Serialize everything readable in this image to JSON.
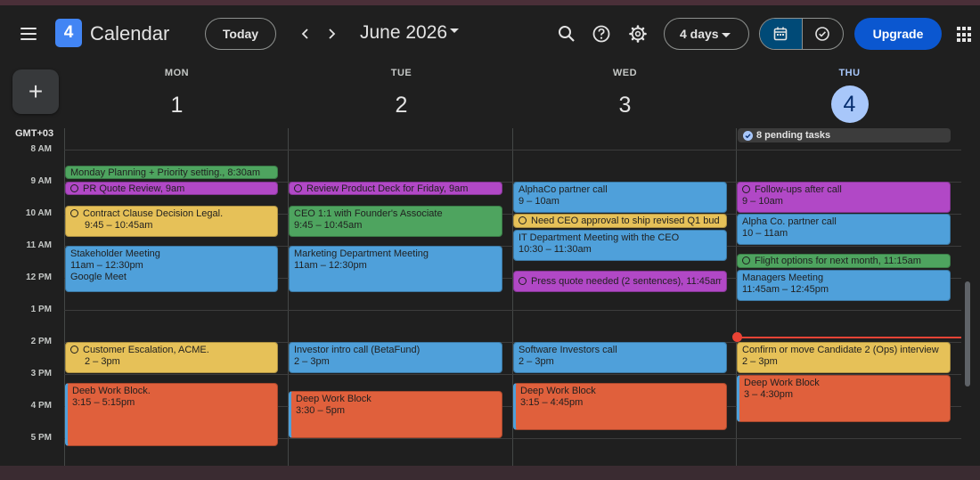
{
  "header": {
    "logo_day": "4",
    "app_title": "Calendar",
    "today_label": "Today",
    "prev_glyph": "‹",
    "next_glyph": "›",
    "month_label": "June 2026",
    "view_label": "4 days",
    "upgrade_label": "Upgrade",
    "icons": [
      "menu-icon",
      "search-icon",
      "help-icon",
      "gear-icon",
      "calendar-icon",
      "tasks-check-icon",
      "apps-grid-icon"
    ]
  },
  "sidebar": {
    "create_glyph": "+",
    "timezone": "GMT+03"
  },
  "days": [
    {
      "dow": "MON",
      "num": "1"
    },
    {
      "dow": "TUE",
      "num": "2"
    },
    {
      "dow": "WED",
      "num": "3"
    },
    {
      "dow": "THU",
      "num": "4"
    }
  ],
  "hours": [
    "8 AM",
    "9 AM",
    "10 AM",
    "11 AM",
    "12 PM",
    "1 PM",
    "2 PM",
    "3 PM",
    "4 PM",
    "5 PM"
  ],
  "pending_tasks": "8 pending tasks",
  "colors": {
    "green": "#4ea45f",
    "purple": "#b148c6",
    "yellow": "#e6c158",
    "blue": "#4fa0da",
    "orange": "#e0603c",
    "today": "#a8c7fa",
    "now_line": "#ea4335"
  },
  "events": {
    "mon": [
      {
        "title": "Monday Planning + Priority setting., 8:30am"
      },
      {
        "title": "PR Quote Review, 9am"
      },
      {
        "title": "Contract Clause Decision Legal.",
        "time": "9:45 – 10:45am"
      },
      {
        "title": "Stakeholder Meeting",
        "time": "11am – 12:30pm",
        "location": "Google Meet"
      },
      {
        "title": "Customer Escalation, ACME.",
        "time": "2 – 3pm"
      },
      {
        "title": "Deeb Work Block.",
        "time": "3:15 – 5:15pm"
      }
    ],
    "tue": [
      {
        "title": "Review Product Deck for Friday, 9am"
      },
      {
        "title": "CEO 1:1 with Founder's Associate",
        "time": "9:45 – 10:45am"
      },
      {
        "title": "Marketing Department Meeting",
        "time": "11am – 12:30pm"
      },
      {
        "title": "Investor intro call (BetaFund)",
        "time": "2 – 3pm"
      },
      {
        "title": "Deep Work Block",
        "time": "3:30 – 5pm"
      }
    ],
    "wed": [
      {
        "title": "AlphaCo partner call",
        "time": "9 – 10am"
      },
      {
        "title": "Need CEO approval to ship revised Q1 bud"
      },
      {
        "title": "IT Department Meeting with the CEO",
        "time": "10:30 – 11:30am"
      },
      {
        "title": "Press quote needed (2 sentences), 11:45am"
      },
      {
        "title": "Software Investors call",
        "time": "2 – 3pm"
      },
      {
        "title": "Deep Work Block",
        "time": "3:15 – 4:45pm"
      }
    ],
    "thu": [
      {
        "title": "Follow-ups after call",
        "time": "9 – 10am"
      },
      {
        "title": "Alpha Co. partner call",
        "time": "10 – 11am"
      },
      {
        "title": "Flight options for next month, 11:15am"
      },
      {
        "title": "Managers Meeting",
        "time": "11:45am – 12:45pm"
      },
      {
        "title": "Confirm or move Candidate 2 (Ops) interview",
        "time": "2 – 3pm"
      },
      {
        "title": "Deep Work Block",
        "time": "3 – 4:30pm"
      }
    ]
  }
}
